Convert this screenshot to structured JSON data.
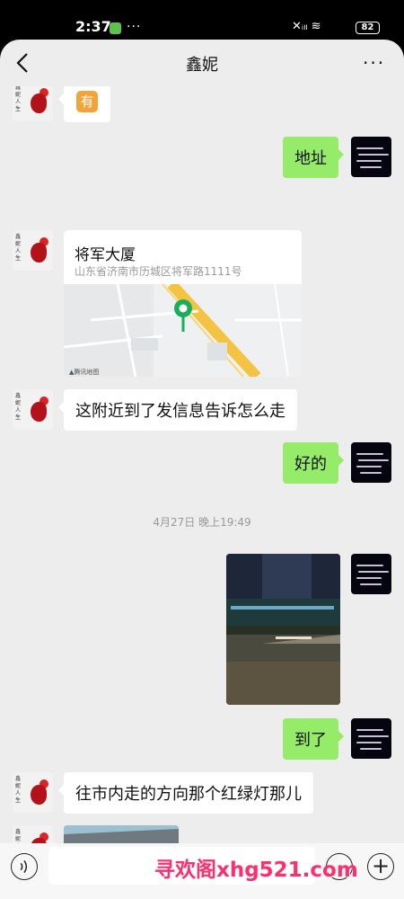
{
  "status_bar": {
    "time": "2:37",
    "more": "···",
    "icons": "✕ᵢₗₗ ≋",
    "battery": "82"
  },
  "nav": {
    "title": "鑫妮",
    "back_icon": "chevron-left",
    "more_icon": "···"
  },
  "messages": [
    {
      "type": "emoji",
      "side": "left",
      "text": "有"
    },
    {
      "type": "text",
      "side": "right",
      "text": "地址"
    },
    {
      "type": "location",
      "side": "left",
      "name": "将军大厦",
      "address": "山东省济南市历城区将军路1111号",
      "map_credit": "▲腾讯地图"
    },
    {
      "type": "text",
      "side": "left",
      "text": "这附近到了发信息告诉怎么走"
    },
    {
      "type": "text",
      "side": "right",
      "text": "好的"
    },
    {
      "type": "timestamp",
      "text": "4月27日 晚上19:49"
    },
    {
      "type": "image",
      "side": "right",
      "description": "night-street-photo"
    },
    {
      "type": "text",
      "side": "right",
      "text": "到了"
    },
    {
      "type": "text",
      "side": "left",
      "text": "往市内走的方向那个红绿灯那儿"
    },
    {
      "type": "image",
      "side": "left",
      "description": "bridge-photo"
    }
  ],
  "avatars": {
    "left_label": "鑫妮人生"
  },
  "input_bar": {
    "placeholder": "",
    "watermark": "寻欢阁xhg521.com"
  },
  "colors": {
    "chat_bg": "#ededed",
    "bubble_self": "#95ec69",
    "bubble_other": "#ffffff",
    "accent_green": "#07c160"
  }
}
